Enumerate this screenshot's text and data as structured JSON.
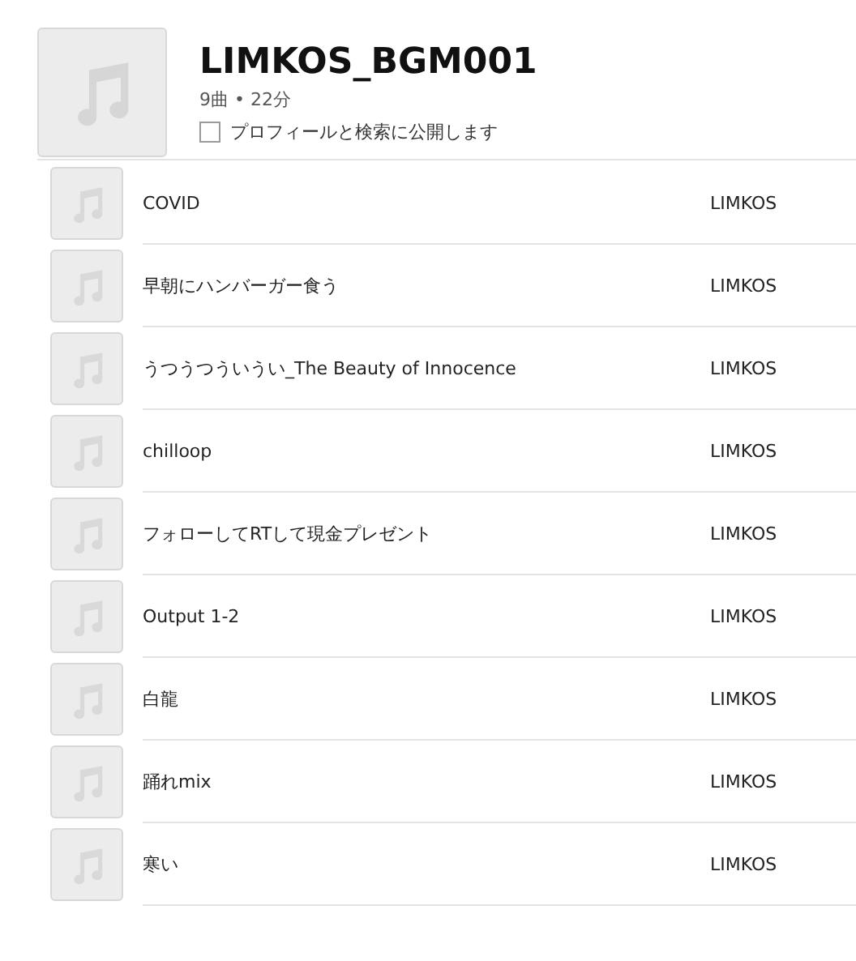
{
  "playlist": {
    "title": "LIMKOS_BGM001",
    "summary": "9曲 • 22分",
    "publish": {
      "label": "プロフィールと検索に公開します",
      "checked": false
    }
  },
  "tracks": [
    {
      "title": "COVID",
      "artist": "LIMKOS"
    },
    {
      "title": "早朝にハンバーガー食う",
      "artist": "LIMKOS"
    },
    {
      "title": "うつうつういうい_The Beauty of Innocence",
      "artist": "LIMKOS"
    },
    {
      "title": "chilloop",
      "artist": "LIMKOS"
    },
    {
      "title": "フォローしてRTして現金プレゼント",
      "artist": "LIMKOS"
    },
    {
      "title": "Output 1-2",
      "artist": "LIMKOS"
    },
    {
      "title": "白龍",
      "artist": "LIMKOS"
    },
    {
      "title": "踊れmix",
      "artist": "LIMKOS"
    },
    {
      "title": "寒い",
      "artist": "LIMKOS"
    }
  ]
}
